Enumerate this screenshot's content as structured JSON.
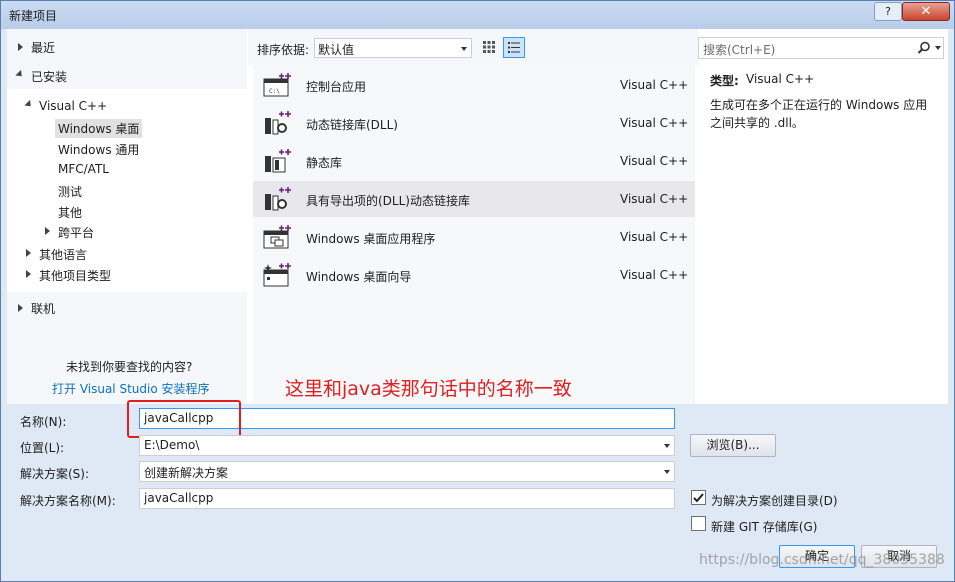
{
  "window": {
    "title": "新建项目",
    "help_label": "?",
    "close_label": "✕"
  },
  "left": {
    "recent": "最近",
    "installed": "已安装",
    "visual_cpp": "Visual C++",
    "cpp_children": [
      "Windows 桌面",
      "Windows 通用",
      "MFC/ATL",
      "测试",
      "其他",
      "跨平台"
    ],
    "other_langs": "其他语言",
    "other_types": "其他项目类型",
    "online": "联机",
    "not_found": "未找到你要查找的内容?",
    "install_link": "打开 Visual Studio 安装程序"
  },
  "sort": {
    "label": "排序依据:",
    "value": "默认值"
  },
  "templates": [
    {
      "name": "控制台应用",
      "lang": "Visual C++",
      "icon": "console-app-icon"
    },
    {
      "name": "动态链接库(DLL)",
      "lang": "Visual C++",
      "icon": "dll-icon"
    },
    {
      "name": "静态库",
      "lang": "Visual C++",
      "icon": "static-lib-icon"
    },
    {
      "name": "具有导出项的(DLL)动态链接库",
      "lang": "Visual C++",
      "icon": "dll-exports-icon"
    },
    {
      "name": "Windows 桌面应用程序",
      "lang": "Visual C++",
      "icon": "desktop-app-icon"
    },
    {
      "name": "Windows 桌面向导",
      "lang": "Visual C++",
      "icon": "desktop-wizard-icon"
    }
  ],
  "search": {
    "placeholder": "搜索(Ctrl+E)"
  },
  "details": {
    "type_label": "类型:",
    "type_value": "Visual C++",
    "description": "生成可在多个正在运行的 Windows 应用之间共享的 .dll。"
  },
  "annotation": {
    "text": "这里和java类那句话中的名称一致",
    "color": "#e02020"
  },
  "form": {
    "name_label": "名称(N):",
    "name_value": "javaCallcpp",
    "location_label": "位置(L):",
    "location_value": "E:\\Demo\\",
    "browse_label": "浏览(B)...",
    "solution_label": "解决方案(S):",
    "solution_value": "创建新解决方案",
    "solution_name_label": "解决方案名称(M):",
    "solution_name_value": "javaCallcpp",
    "create_dir_label": "为解决方案创建目录(D)",
    "create_dir_checked": true,
    "git_label": "新建 GIT 存储库(G)",
    "git_checked": false,
    "ok_label": "确定",
    "cancel_label": "取消"
  },
  "watermark": "https://blog.csdn.net/qq_38055388",
  "colors": {
    "link": "#0e70c0",
    "selection": "#e8e8ec"
  }
}
